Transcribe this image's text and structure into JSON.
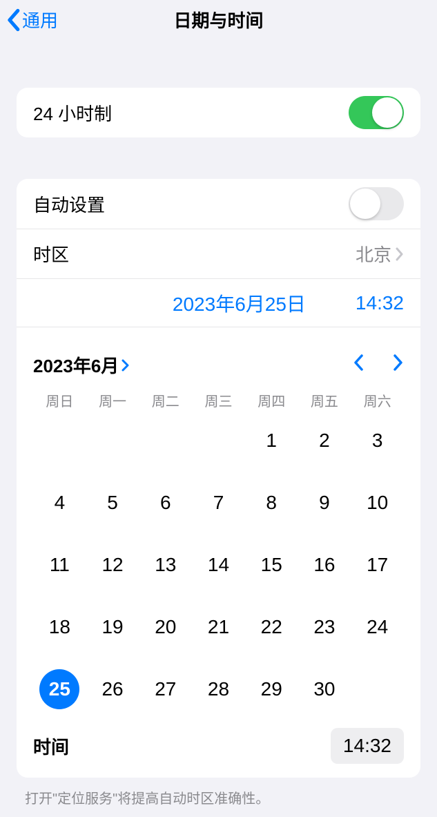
{
  "header": {
    "back_label": "通用",
    "title": "日期与时间"
  },
  "settings": {
    "twenty_four_hour_label": "24 小时制",
    "twenty_four_hour_on": true,
    "auto_set_label": "自动设置",
    "auto_set_on": false,
    "timezone_label": "时区",
    "timezone_value": "北京",
    "selected_date_display": "2023年6月25日",
    "selected_time_display": "14:32"
  },
  "calendar": {
    "month_label": "2023年6月",
    "weekdays": [
      "周日",
      "周一",
      "周二",
      "周三",
      "周四",
      "周五",
      "周六"
    ],
    "leading_blanks": 4,
    "days": [
      "1",
      "2",
      "3",
      "4",
      "5",
      "6",
      "7",
      "8",
      "9",
      "10",
      "11",
      "12",
      "13",
      "14",
      "15",
      "16",
      "17",
      "18",
      "19",
      "20",
      "21",
      "22",
      "23",
      "24",
      "25",
      "26",
      "27",
      "28",
      "29",
      "30"
    ],
    "selected_day": "25",
    "time_label": "时间",
    "time_value": "14:32"
  },
  "footnote": "打开\"定位服务\"将提高自动时区准确性。"
}
